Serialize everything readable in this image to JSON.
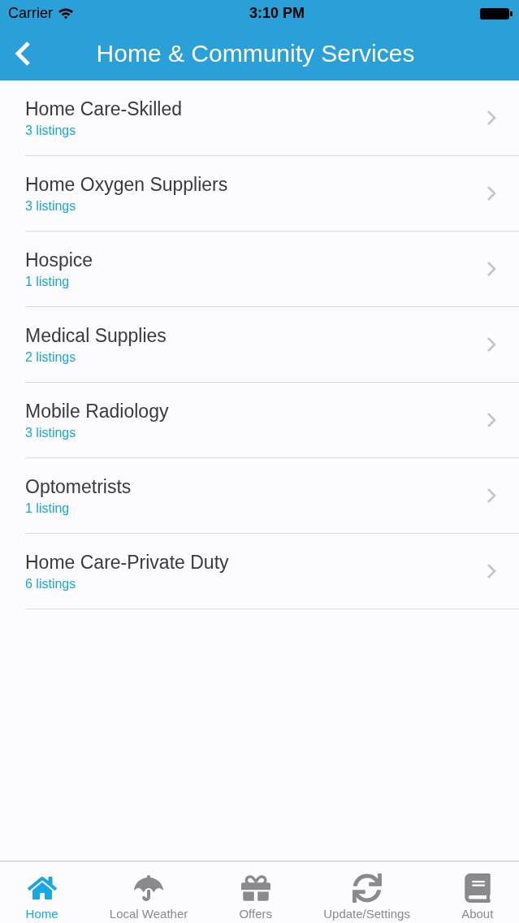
{
  "status_bar": {
    "carrier": "Carrier",
    "time": "3:10 PM"
  },
  "nav_bar": {
    "title": "Home & Community Services"
  },
  "categories": [
    {
      "name": "Home Care-Skilled",
      "count": "3 listings"
    },
    {
      "name": "Home Oxygen Suppliers",
      "count": "3 listings"
    },
    {
      "name": "Hospice",
      "count": "1 listing"
    },
    {
      "name": "Medical Supplies",
      "count": "2 listings"
    },
    {
      "name": "Mobile Radiology",
      "count": "3 listings"
    },
    {
      "name": "Optometrists",
      "count": "1 listing"
    },
    {
      "name": "Home Care-Private Duty",
      "count": "6 listings"
    }
  ],
  "tab_bar": [
    {
      "label": "Home",
      "selected": true
    },
    {
      "label": "Local Weather",
      "selected": false
    },
    {
      "label": "Offers",
      "selected": false
    },
    {
      "label": "Update/Settings",
      "selected": false
    },
    {
      "label": "About",
      "selected": false
    }
  ]
}
